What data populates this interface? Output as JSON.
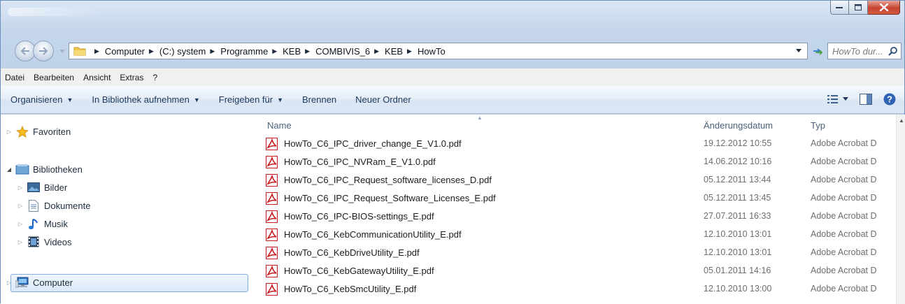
{
  "window": {
    "title": "",
    "minimize_icon": "minimize-icon",
    "maximize_icon": "maximize-icon",
    "close_icon": "close-icon"
  },
  "navbar": {
    "breadcrumbs": [
      "Computer",
      "(C:) system",
      "Programme",
      "KEB",
      "COMBIVIS_6",
      "KEB",
      "HowTo"
    ],
    "search_placeholder": "HowTo dur..."
  },
  "menu": [
    "Datei",
    "Bearbeiten",
    "Ansicht",
    "Extras",
    "?"
  ],
  "commands": {
    "organize": "Organisieren",
    "library": "In Bibliothek aufnehmen",
    "share": "Freigeben für",
    "burn": "Brennen",
    "new_folder": "Neuer Ordner"
  },
  "sidebar": {
    "favorites": "Favoriten",
    "libraries": "Bibliotheken",
    "library_items": [
      "Bilder",
      "Dokumente",
      "Musik",
      "Videos"
    ],
    "computer": "Computer"
  },
  "columns": {
    "name": "Name",
    "date": "Änderungsdatum",
    "type": "Typ"
  },
  "files": [
    {
      "name": "HowTo_C6_IPC_driver_change_E_V1.0.pdf",
      "date": "19.12.2012 10:55",
      "type": "Adobe Acrobat D"
    },
    {
      "name": "HowTo_C6_IPC_NVRam_E_V1.0.pdf",
      "date": "14.06.2012 10:16",
      "type": "Adobe Acrobat D"
    },
    {
      "name": "HowTo_C6_IPC_Request_software_licenses_D.pdf",
      "date": "05.12.2011 13:44",
      "type": "Adobe Acrobat D"
    },
    {
      "name": "HowTo_C6_IPC_Request_Software_Licenses_E.pdf",
      "date": "05.12.2011 13:45",
      "type": "Adobe Acrobat D"
    },
    {
      "name": "HowTo_C6_IPC-BIOS-settings_E.pdf",
      "date": "27.07.2011 16:33",
      "type": "Adobe Acrobat D"
    },
    {
      "name": "HowTo_C6_KebCommunicationUtility_E.pdf",
      "date": "12.10.2010 13:01",
      "type": "Adobe Acrobat D"
    },
    {
      "name": "HowTo_C6_KebDriveUtility_E.pdf",
      "date": "12.10.2010 13:01",
      "type": "Adobe Acrobat D"
    },
    {
      "name": "HowTo_C6_KebGatewayUtility_E.pdf",
      "date": "05.01.2011 14:16",
      "type": "Adobe Acrobat D"
    },
    {
      "name": "HowTo_C6_KebSmcUtility_E.pdf",
      "date": "12.10.2010 13:00",
      "type": "Adobe Acrobat D"
    }
  ],
  "colors": {
    "pdf_red": "#c8191c",
    "close_red": "#c7442e",
    "window_blue": "#c6d7ec",
    "selection_border": "#84acdd"
  }
}
